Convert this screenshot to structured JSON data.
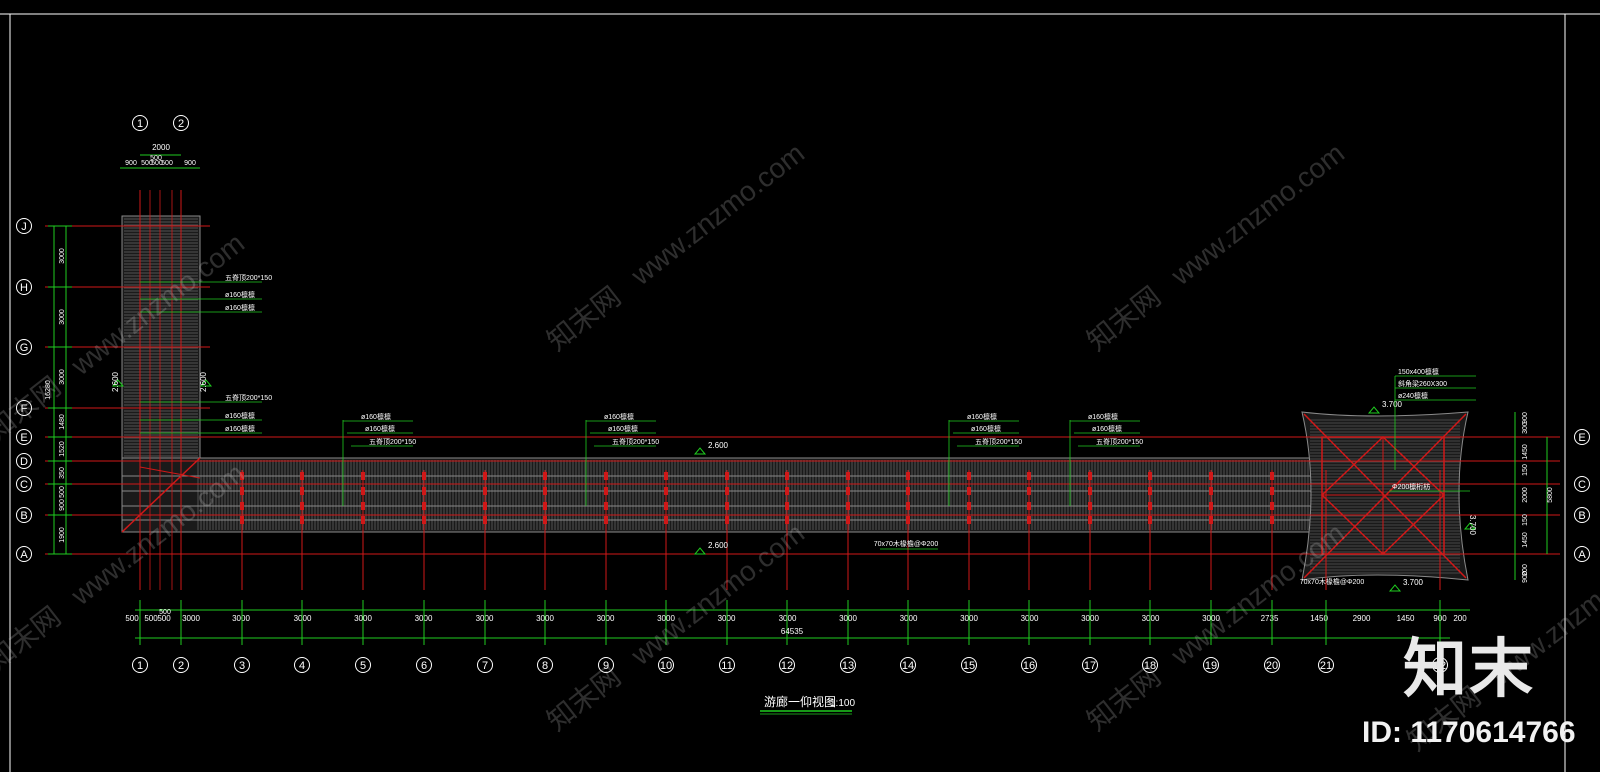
{
  "drawing": {
    "title": "游廊一仰视图",
    "scale": "1:100",
    "total_dimension": "64535",
    "col_axes": [
      "1",
      "2",
      "3",
      "4",
      "5",
      "6",
      "7",
      "8",
      "9",
      "10",
      "11",
      "12",
      "13",
      "14",
      "15",
      "16",
      "17",
      "18",
      "19",
      "20",
      "21",
      "22"
    ],
    "row_axes_left": [
      "J",
      "H",
      "G",
      "F",
      "E",
      "D",
      "C",
      "B",
      "A"
    ],
    "row_axes_right": [
      "E",
      "C",
      "B",
      "A"
    ],
    "bottom_dims": [
      "500",
      "500",
      "500",
      "3000",
      "3000",
      "3000",
      "3000",
      "3000",
      "3000",
      "3000",
      "3000",
      "3000",
      "3000",
      "3000",
      "3000",
      "3000",
      "3000",
      "3000",
      "3000",
      "3000",
      "3000",
      "2735",
      "1450",
      "2900",
      "1450",
      "900",
      "200"
    ],
    "bottom_dim_sub": "500",
    "top_dims": [
      "900",
      "500",
      "500",
      "500",
      "900"
    ],
    "top_dim_total": "2000",
    "top_dim_sub": "500",
    "left_dims": [
      "3000",
      "3000",
      "3000",
      "1480",
      "1520",
      "350",
      "500",
      "900",
      "1900"
    ],
    "left_dim_total": "16280",
    "right_dims": [
      "900",
      "300",
      "1450",
      "150",
      "2000",
      "150",
      "1450",
      "200",
      "900"
    ],
    "right_dim_total": "5800",
    "elevations": [
      "2.600",
      "2.600",
      "2.600",
      "2.600",
      "3.700",
      "3.700",
      "3.700"
    ],
    "callouts_left": [
      "五脊顶200*150",
      "ø160檩檩",
      "ø160檩檩",
      "五脊顶200*150",
      "ø160檩檩",
      "ø160檩檩"
    ],
    "callout_groups": [
      [
        "ø160檩檩",
        "ø160檩檩",
        "五脊顶200*150"
      ],
      [
        "ø160檩檩",
        "ø160檩檩",
        "五脊顶200*150"
      ],
      [
        "ø160檩檩",
        "ø160檩檩",
        "五脊顶200*150"
      ],
      [
        "ø160檩檩",
        "ø160檩檩",
        "五脊顶200*150"
      ]
    ],
    "callouts_pavilion": [
      "150x400檩檩",
      "斜角梁260X300",
      "ø240檩檩",
      "Φ200檩桁枋"
    ],
    "purlin_notes": [
      "70x70木椽檐@Φ200",
      "70x70木椽檐@Φ200"
    ]
  },
  "watermark": {
    "site": "znzmo.com",
    "site_long": "www.znzmo.com",
    "brand_cn": "知末网"
  },
  "logo": {
    "text": "知末",
    "id_label": "ID: 1170614766"
  },
  "colors": {
    "background": "#000000",
    "structure": "#d01818",
    "dimension": "#1fcc1f",
    "text": "#ffffff",
    "hatch": "#8a8a8a"
  }
}
